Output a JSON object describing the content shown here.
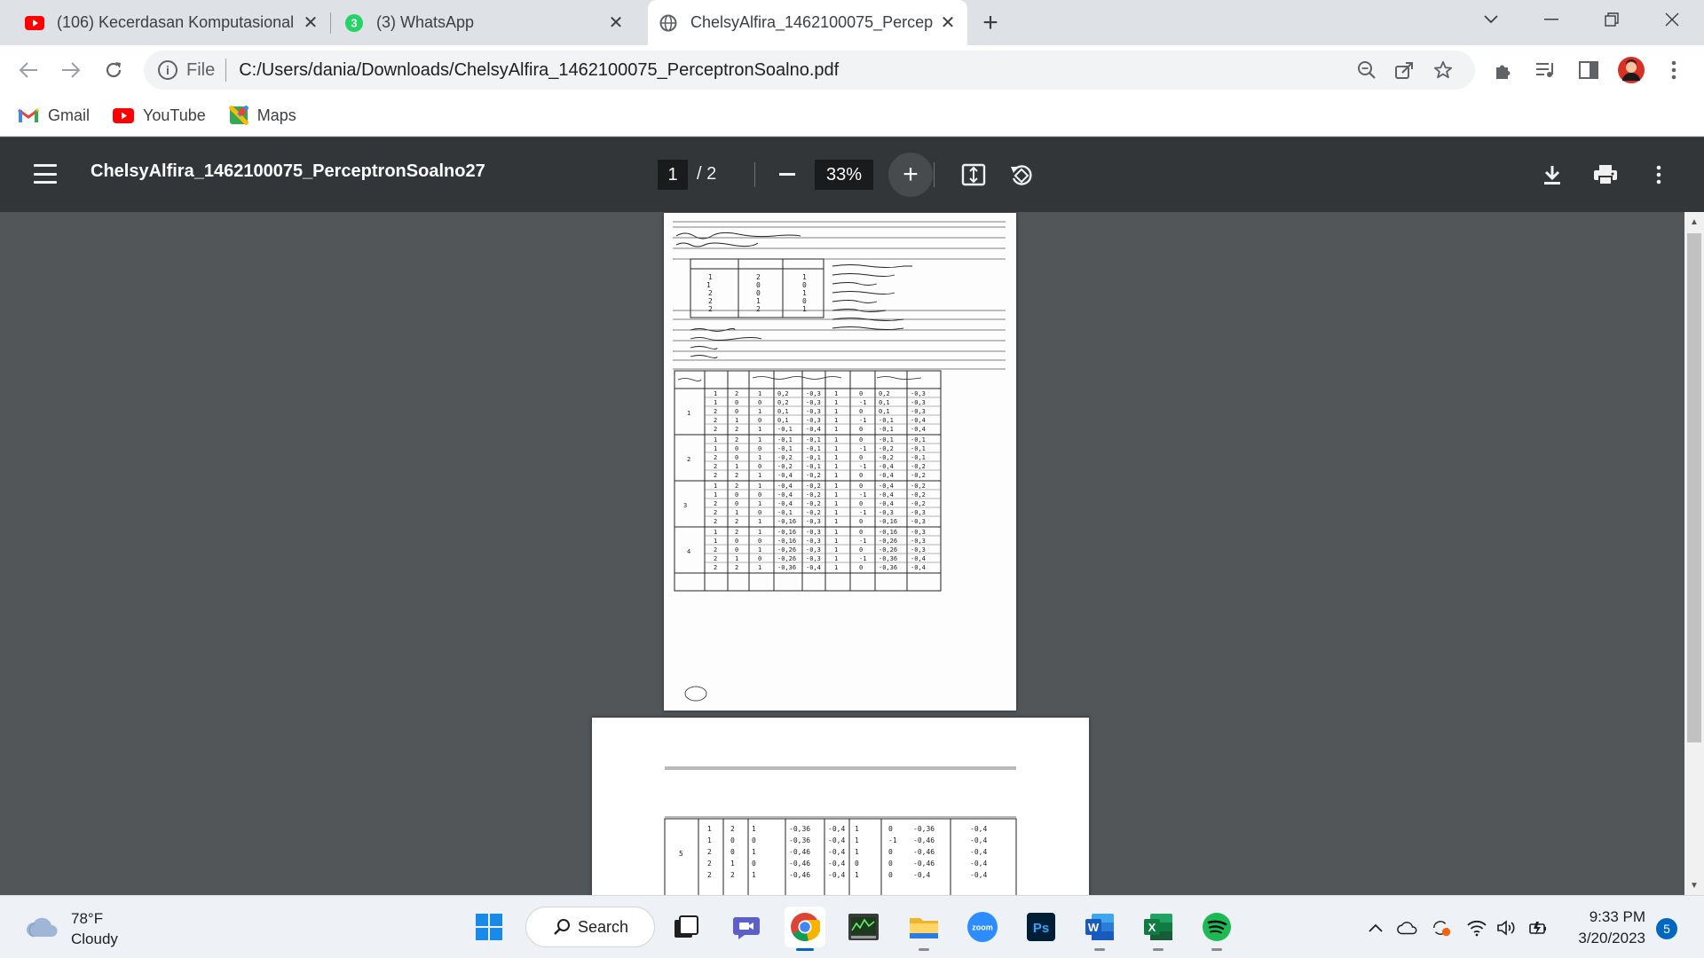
{
  "tabs": [
    {
      "title": "(106) Kecerdasan Komputasional",
      "icon": "youtube-icon"
    },
    {
      "title": "(3) WhatsApp",
      "icon": "whatsapp-icon",
      "badge": "3"
    },
    {
      "title": "ChelsyAlfira_1462100075_Percep",
      "icon": "globe-icon"
    }
  ],
  "address": {
    "scheme": "File",
    "url": "C:/Users/dania/Downloads/ChelsyAlfira_1462100075_PerceptronSoalno.pdf"
  },
  "bookmarks": [
    {
      "label": "Gmail",
      "icon": "gmail-icon"
    },
    {
      "label": "YouTube",
      "icon": "youtube-icon"
    },
    {
      "label": "Maps",
      "icon": "maps-icon"
    }
  ],
  "pdf": {
    "title": "ChelsyAlfira_1462100075_PerceptronSoalno27",
    "current_page": "1",
    "page_total": "/ 2",
    "zoom": "33%"
  },
  "taskbar": {
    "weather_temp": "78°F",
    "weather_desc": "Cloudy",
    "search_label": "Search",
    "time": "9:33 PM",
    "date": "3/20/2023",
    "notification_count": "5"
  },
  "colors": {
    "pdf_toolbar": "#323639",
    "viewer_bg": "#525659",
    "tabstrip": "#dee1e6",
    "accent": "#0067c0"
  }
}
